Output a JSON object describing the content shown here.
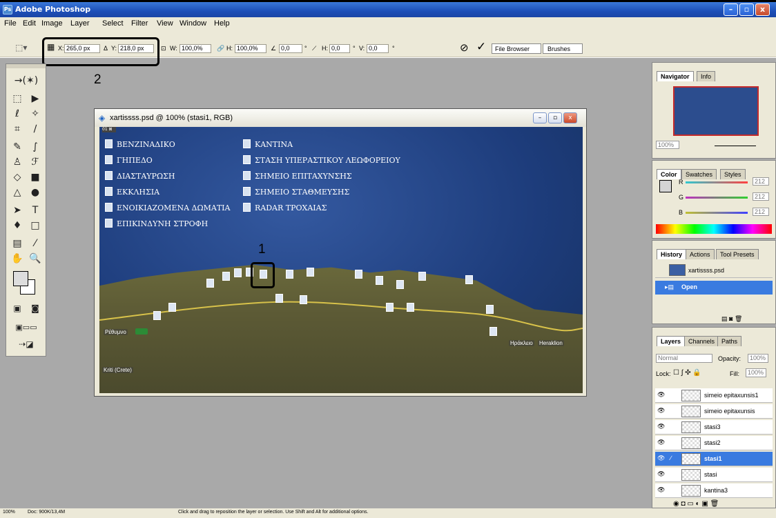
{
  "app": {
    "title": "Adobe Photoshop"
  },
  "menu": [
    "File",
    "Edit",
    "Image",
    "Layer",
    "Select",
    "Filter",
    "View",
    "Window",
    "Help"
  ],
  "options": {
    "x_label": "X:",
    "x_value": "265,0 px",
    "y_label": "Y:",
    "y_value": "218,0 px",
    "w_label": "W:",
    "w_value": "100,0%",
    "h_label": "H:",
    "h_value": "100,0%",
    "angle_value": "0,0",
    "angle_unit": "°",
    "hskew_label": "H:",
    "hskew_value": "0,0",
    "vskew_label": "V:",
    "vskew_value": "0,0",
    "deg": "°",
    "file_browser": "File Browser",
    "brushes": "Brushes"
  },
  "callouts": {
    "one": "1",
    "two": "2"
  },
  "document": {
    "title": "xartissss.psd @ 100% (stasi1, RGB)",
    "legend_left": [
      "ΒΕΝΖΙΝΑΔΙΚΟ",
      "ΓΗΠΕΔΟ",
      "ΔΙΑΣΤΑΥΡΩΣΗ",
      "ΕΚΚΛΗΣΙΑ",
      "ΕΝΟΙΚΙΑΖΟΜΕΝΑ ΔΩΜΑΤΙΑ",
      "ΕΠΙΚΙΝΔΥΝΗ ΣΤΡΟΦΗ"
    ],
    "legend_right": [
      "ΚΑΝΤΙΝΑ",
      "ΣΤΑΣΗ ΥΠΕΡΑΣΤΙΚΟΥ ΛΕΩΦΟΡΕΙΟΥ",
      "ΣΗΜΕΙΟ ΕΠΙΤΑΧΥΝΣΗΣ",
      "ΣΗΜΕΙΟ ΣΤΑΘΜΕΥΣΗΣ",
      "RADAR ΤΡΟΧΑΙΑΣ"
    ],
    "map_labels": {
      "rethymno": "Ρέθυμνο",
      "iraklio": "Ηράκλειο",
      "heraklion": "Heraklion",
      "kriti": "Kriti (Crete)"
    }
  },
  "navigator": {
    "tabs": [
      "Navigator",
      "Info"
    ],
    "zoom": "100%"
  },
  "color": {
    "tabs": [
      "Color",
      "Swatches",
      "Styles"
    ],
    "r_label": "R",
    "g_label": "G",
    "b_label": "B",
    "r": "212",
    "g": "212",
    "b": "212"
  },
  "history": {
    "tabs": [
      "History",
      "Actions",
      "Tool Presets"
    ],
    "snapshot": "xartissss.psd",
    "state": "Open"
  },
  "layers": {
    "tabs": [
      "Layers",
      "Channels",
      "Paths"
    ],
    "blend": "Normal",
    "opacity_label": "Opacity:",
    "opacity": "100%",
    "lock_label": "Lock:",
    "fill_label": "Fill:",
    "fill": "100%",
    "rows": [
      "simeio epitaxunsis1",
      "simeio epitaxunsis",
      "stasi3",
      "stasi2",
      "stasi1",
      "stasi",
      "kantina3"
    ]
  },
  "status": {
    "zoom": "100%",
    "doc": "Doc: 900K/13,4M",
    "hint": "Click and drag to reposition the layer or selection. Use Shift and Alt for additional options."
  },
  "colors": {
    "selection": "#3a7be0",
    "workspace": "#a9a9a9"
  }
}
